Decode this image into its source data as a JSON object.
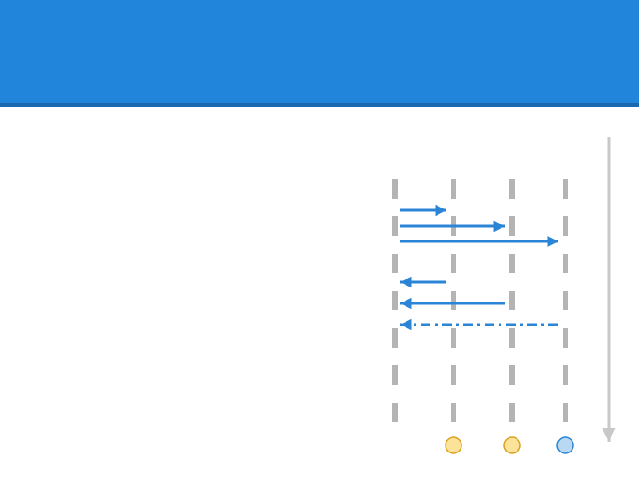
{
  "colors": {
    "header": "#2285dc",
    "header_rule": "#1a68b0",
    "arrow": "#2a85d6",
    "lifeline": "#b4b4b4",
    "time_axis": "#c8c8c8",
    "yellow_node_fill": "#fde39a",
    "yellow_node_stroke": "#d9a11f",
    "blue_node_fill": "#b9d8f2",
    "blue_node_stroke": "#2a85d6"
  },
  "diagram": {
    "lifelines": [
      {
        "node": "none"
      },
      {
        "node": "yellow"
      },
      {
        "node": "yellow"
      },
      {
        "node": "blue"
      }
    ],
    "messages": [
      {
        "from": 0,
        "to": 1,
        "style": "solid"
      },
      {
        "from": 0,
        "to": 2,
        "style": "solid"
      },
      {
        "from": 0,
        "to": 3,
        "style": "solid"
      },
      {
        "from": 1,
        "to": 0,
        "style": "solid"
      },
      {
        "from": 2,
        "to": 0,
        "style": "solid"
      },
      {
        "from": 3,
        "to": 0,
        "style": "dash-dot"
      }
    ],
    "time_axis": {
      "direction": "down"
    }
  }
}
